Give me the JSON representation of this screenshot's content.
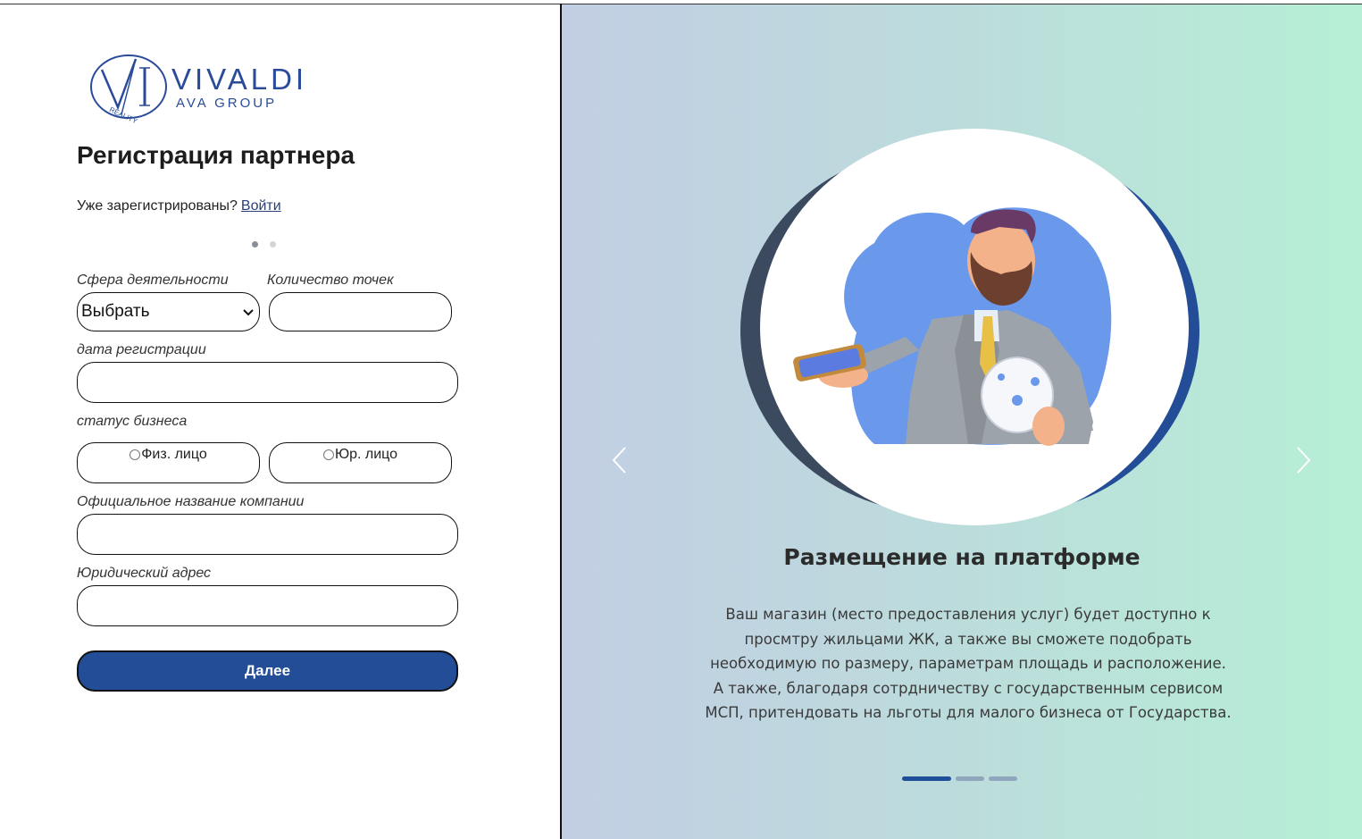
{
  "brand": {
    "monogram": "VI",
    "name": "VIVALDI",
    "group": "AVA GROUP",
    "seal_text": "REALITY",
    "color": "#2a4a9a"
  },
  "form": {
    "title": "Регистрация партнера",
    "already_text": "Уже зарегистрированы?",
    "login_link": "Войти",
    "steps_total": 2,
    "step_active": 1,
    "activity_label": "Сфера деятельности",
    "activity_value": "Выбрать",
    "points_label": "Количество точек",
    "points_value": "",
    "date_label": "дата регистрации",
    "date_value": "",
    "status_label": "статус бизнеса",
    "status_options": [
      "Физ. лицо",
      "Юр. лицо"
    ],
    "company_label": "Официальное название компании",
    "company_value": "",
    "address_label": "Юридический адрес",
    "address_value": "",
    "next_button": "Далее",
    "button_color": "#234d97"
  },
  "carousel": {
    "prev_icon": "chevron-left-icon",
    "next_icon": "chevron-right-icon",
    "slide_title": "Размещение на платформе",
    "slide_text": "Ваш магазин (место предоставления услуг) будет доступно к просмтру жильцами ЖК, а также вы сможете подобрать необходимую по размеру, параметрам площадь и расположение. А также, благодаря сотрдничеству с государственным сервисом МСП, притендовать на льготы для малого бизнеса от Государства.",
    "slides_total": 3,
    "slide_active": 1,
    "active_color": "#1f4f99"
  }
}
